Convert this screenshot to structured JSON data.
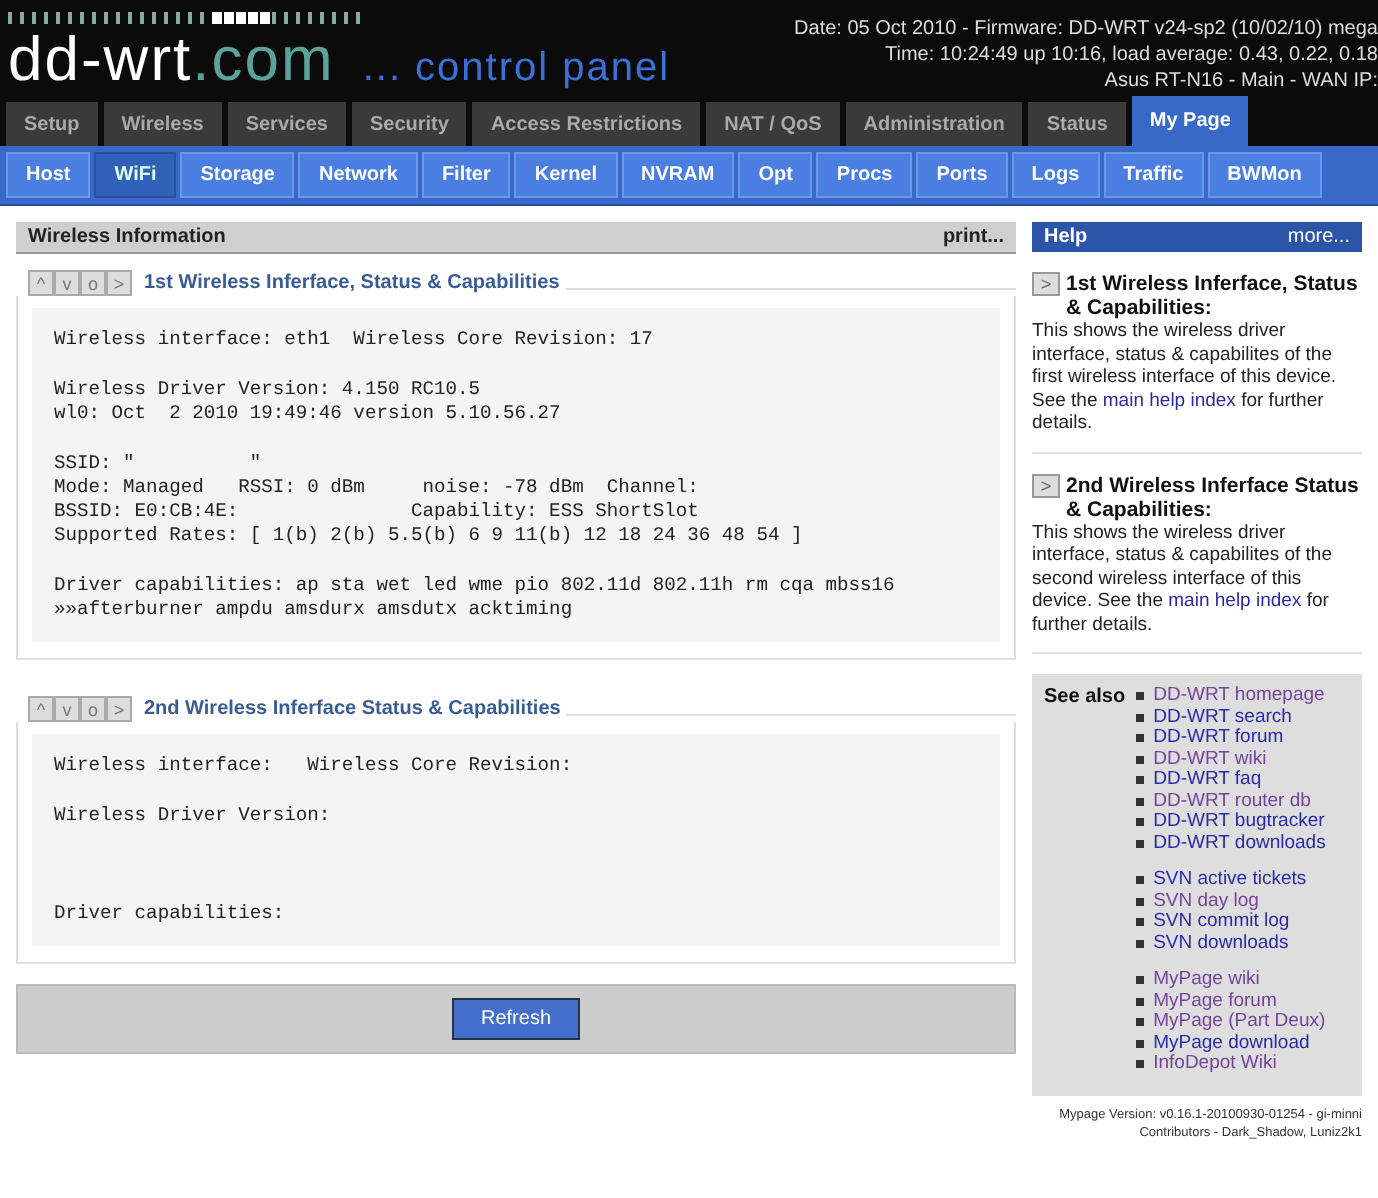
{
  "header": {
    "logo": {
      "main": "dd-wrt",
      "suffix": ".com",
      "tagline": "... control panel"
    },
    "info": [
      "Date: 05 Oct 2010 - Firmware: DD-WRT v24-sp2 (10/02/10) mega",
      "Time: 10:24:49 up 10:16, load average: 0.43, 0.22, 0.18",
      "Asus RT-N16 - Main - WAN  IP:"
    ]
  },
  "main_tabs": [
    {
      "label": "Setup",
      "selected": false
    },
    {
      "label": "Wireless",
      "selected": false
    },
    {
      "label": "Services",
      "selected": false
    },
    {
      "label": "Security",
      "selected": false
    },
    {
      "label": "Access Restrictions",
      "selected": false
    },
    {
      "label": "NAT / QoS",
      "selected": false
    },
    {
      "label": "Administration",
      "selected": false
    },
    {
      "label": "Status",
      "selected": false
    },
    {
      "label": "My Page",
      "selected": true
    }
  ],
  "sub_tabs": [
    {
      "label": "Host",
      "selected": false
    },
    {
      "label": "WiFi",
      "selected": true
    },
    {
      "label": "Storage",
      "selected": false
    },
    {
      "label": "Network",
      "selected": false
    },
    {
      "label": "Filter",
      "selected": false
    },
    {
      "label": "Kernel",
      "selected": false
    },
    {
      "label": "NVRAM",
      "selected": false
    },
    {
      "label": "Opt",
      "selected": false
    },
    {
      "label": "Procs",
      "selected": false
    },
    {
      "label": "Ports",
      "selected": false
    },
    {
      "label": "Logs",
      "selected": false
    },
    {
      "label": "Traffic",
      "selected": false
    },
    {
      "label": "BWMon",
      "selected": false
    }
  ],
  "content": {
    "title": "Wireless Information",
    "print": "print...",
    "sections": [
      {
        "controls": [
          "^",
          "v",
          "o",
          ">"
        ],
        "title": "1st Wireless Inferface, Status & Capabilities",
        "paragraphs": [
          [
            "Wireless interface: eth1  Wireless Core Revision: 17"
          ],
          [
            "Wireless Driver Version: 4.150 RC10.5",
            "wl0: Oct  2 2010 19:49:46 version 5.10.56.27"
          ],
          [
            "SSID: \"          \"",
            "Mode: Managed   RSSI: 0 dBm     noise: -78 dBm  Channel:",
            "BSSID: E0:CB:4E:               Capability: ESS ShortSlot",
            "Supported Rates: [ 1(b) 2(b) 5.5(b) 6 9 11(b) 12 18 24 36 48 54 ]"
          ],
          [
            "Driver capabilities: ap sta wet led wme pio 802.11d 802.11h rm cqa mbss16",
            "»»afterburner ampdu amsdurx amsdutx acktiming"
          ]
        ]
      },
      {
        "controls": [
          "^",
          "v",
          "o",
          ">"
        ],
        "title": "2nd Wireless Inferface Status & Capabilities",
        "paragraphs": [
          [
            "Wireless interface:   Wireless Core Revision:"
          ],
          [
            "Wireless Driver Version:"
          ],
          [
            "Driver capabilities:"
          ]
        ]
      }
    ],
    "refresh": "Refresh"
  },
  "help": {
    "title": "Help",
    "more": "more...",
    "entries": [
      {
        "icon": ">",
        "title": "1st Wireless Inferface, Status & Capabilities:",
        "before": "This shows the wireless driver interface, status & capabilites of the first wireless interface of this device. See the",
        "link": "main help index",
        "after": "for further details."
      },
      {
        "icon": ">",
        "title": "2nd Wireless Inferface Status & Capabilities:",
        "before": "This shows the wireless driver interface, status & capabilites of the second wireless interface of this device. See the",
        "link": "main help index",
        "after": "for further details."
      }
    ],
    "see_also": {
      "label": "See also",
      "groups": [
        [
          {
            "text": "DD-WRT homepage",
            "visited": true
          },
          {
            "text": "DD-WRT search",
            "visited": false
          },
          {
            "text": "DD-WRT forum",
            "visited": false
          },
          {
            "text": "DD-WRT wiki",
            "visited": true
          },
          {
            "text": "DD-WRT faq",
            "visited": false
          },
          {
            "text": "DD-WRT router db",
            "visited": true
          },
          {
            "text": "DD-WRT bugtracker",
            "visited": false
          },
          {
            "text": "DD-WRT downloads",
            "visited": false
          }
        ],
        [
          {
            "text": "SVN active tickets",
            "visited": false
          },
          {
            "text": "SVN day log",
            "visited": true
          },
          {
            "text": "SVN commit log",
            "visited": false
          },
          {
            "text": "SVN downloads",
            "visited": false
          }
        ],
        [
          {
            "text": "MyPage wiki",
            "visited": true
          },
          {
            "text": "MyPage forum",
            "visited": true
          },
          {
            "text": "MyPage (Part Deux)",
            "visited": true
          },
          {
            "text": "MyPage download",
            "visited": false
          },
          {
            "text": "InfoDepot Wiki",
            "visited": true
          }
        ]
      ]
    },
    "footer": [
      "Mypage Version: v0.16.1-20100930-01254 - gi-minni",
      "Contributors - Dark_Shadow, Luniz2k1"
    ]
  }
}
